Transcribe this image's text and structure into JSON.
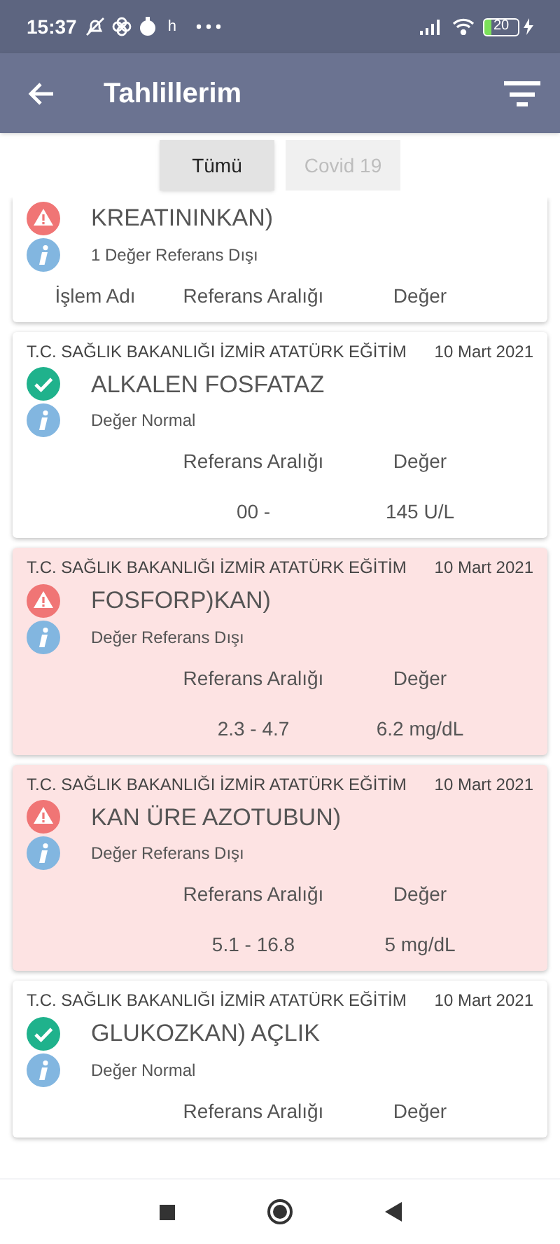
{
  "status_bar": {
    "time": "15:37",
    "misc": "h",
    "battery": "20"
  },
  "app_bar": {
    "title": "Tahlillerim"
  },
  "tabs": [
    {
      "label": "Tümü",
      "selected": true
    },
    {
      "label": "Covid 19",
      "selected": false
    }
  ],
  "cards": [
    {
      "kind": "abnormal",
      "highlighted": false,
      "name": "KREATININKAN)",
      "summary": "1 Değer Referans Dışı",
      "columns": [
        "İşlem Adı",
        "Referans Aralığı",
        "Değer"
      ]
    },
    {
      "hospital": "T.C. SAĞLIK BAKANLIĞI İZMİR ATATÜRK EĞİTİM",
      "date": "10 Mart 2021",
      "kind": "normal",
      "highlighted": false,
      "name": "ALKALEN FOSFATAZ",
      "summary": "Değer Normal",
      "columns": [
        "Referans Aralığı",
        "Değer"
      ],
      "values": [
        "00 -",
        "145 U/L"
      ]
    },
    {
      "hospital": "T.C. SAĞLIK BAKANLIĞI İZMİR ATATÜRK EĞİTİM",
      "date": "10 Mart 2021",
      "kind": "abnormal",
      "highlighted": true,
      "name": "FOSFORP)KAN)",
      "summary": "Değer Referans Dışı",
      "columns": [
        "Referans Aralığı",
        "Değer"
      ],
      "values": [
        "2.3 - 4.7",
        "6.2 mg/dL"
      ]
    },
    {
      "hospital": "T.C. SAĞLIK BAKANLIĞI İZMİR ATATÜRK EĞİTİM",
      "date": "10 Mart 2021",
      "kind": "abnormal",
      "highlighted": true,
      "name": "KAN ÜRE AZOTUBUN)",
      "summary": "Değer Referans Dışı",
      "columns": [
        "Referans Aralığı",
        "Değer"
      ],
      "values": [
        "5.1 - 16.8",
        "5 mg/dL"
      ]
    },
    {
      "hospital": "T.C. SAĞLIK BAKANLIĞI İZMİR ATATÜRK EĞİTİM",
      "date": "10 Mart 2021",
      "kind": "normal",
      "highlighted": false,
      "name": "GLUKOZKAN) AÇLIK",
      "summary": "Değer Normal",
      "columns": [
        "Referans Aralığı",
        "Değer"
      ]
    }
  ]
}
